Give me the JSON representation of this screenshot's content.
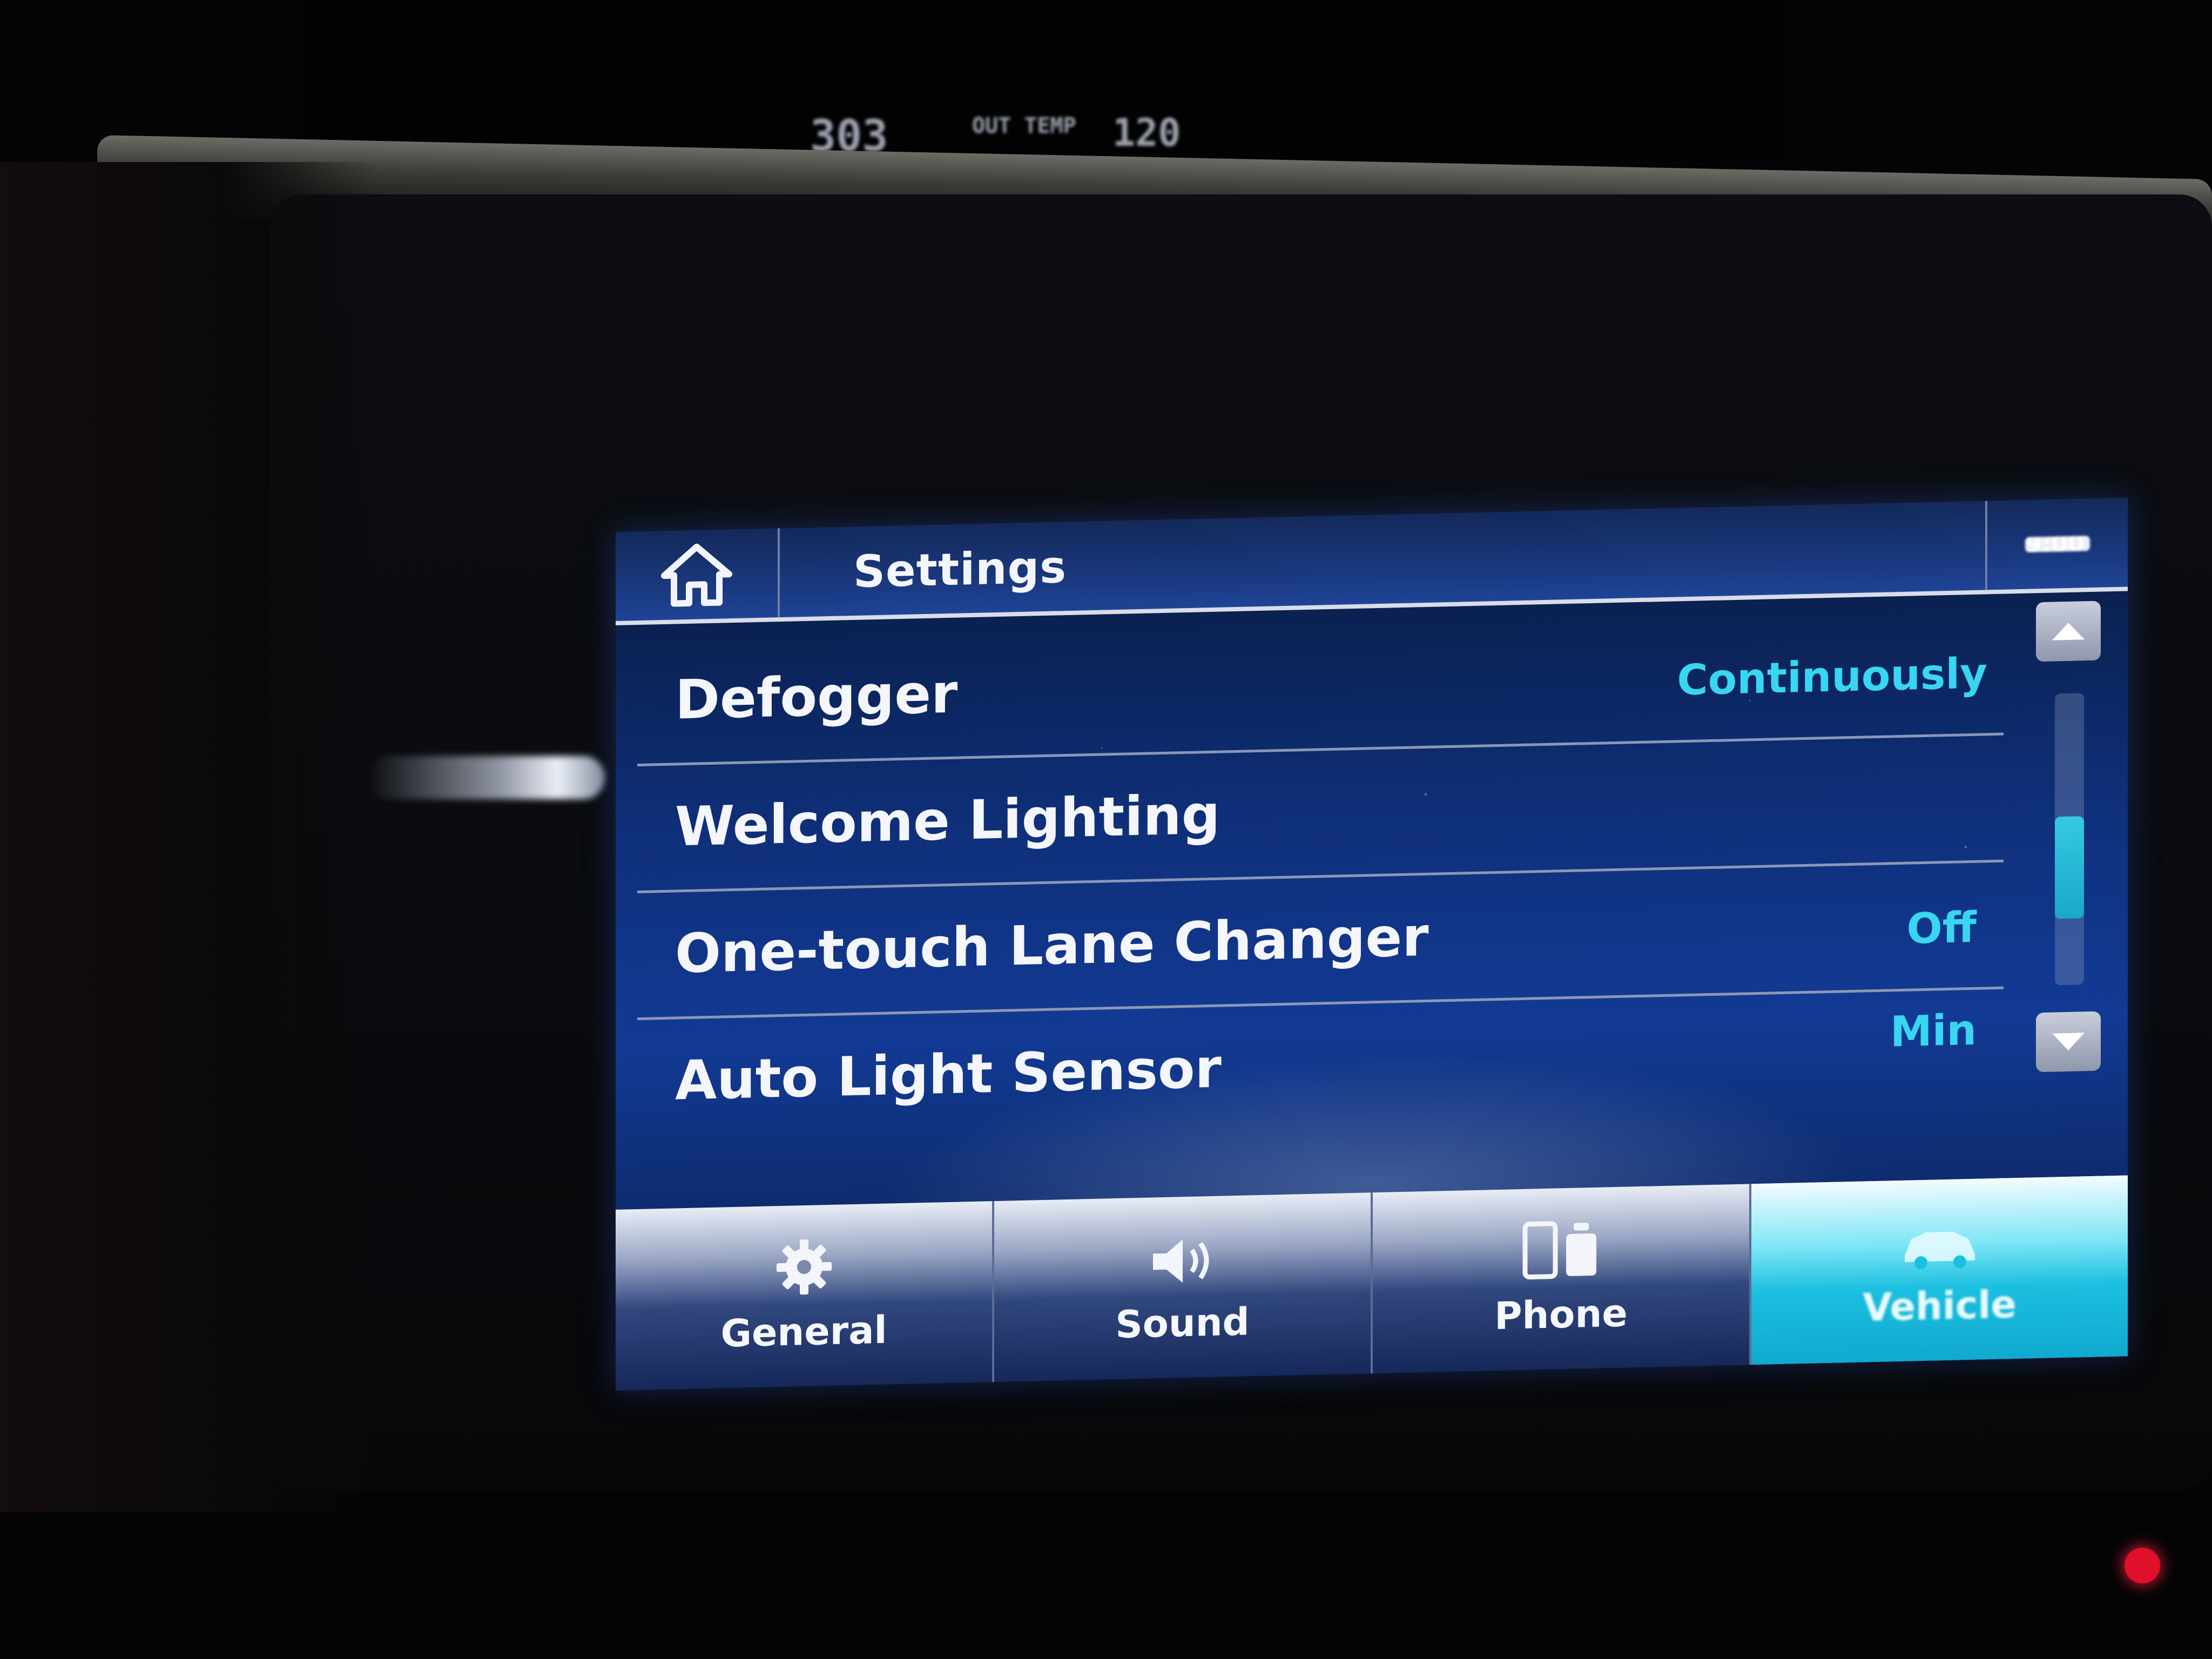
{
  "upper_display": {
    "left_value": "303",
    "out_temp_label": "OUT TEMP",
    "right_value": "120"
  },
  "header": {
    "title": "Settings",
    "clock": "9:00"
  },
  "settings": [
    {
      "label": "Defogger",
      "value": "Continuously"
    },
    {
      "label": "Welcome Lighting",
      "value": ""
    },
    {
      "label": "One-touch Lane Changer",
      "value": "Off"
    },
    {
      "label": "Auto Light Sensor",
      "value": "Min"
    }
  ],
  "scroll": {
    "position": 0.65,
    "visible_fraction": 0.35
  },
  "tabs": [
    {
      "label": "General",
      "icon": "gear-icon",
      "active": false
    },
    {
      "label": "Sound",
      "icon": "speaker-icon",
      "active": false
    },
    {
      "label": "Phone",
      "icon": "phone-icon",
      "active": false
    },
    {
      "label": "Vehicle",
      "icon": "car-icon",
      "active": true
    }
  ],
  "colors": {
    "accent": "#38d6f0",
    "active_tab": "#1bbfe0",
    "indicator_led": "#e0102a"
  }
}
